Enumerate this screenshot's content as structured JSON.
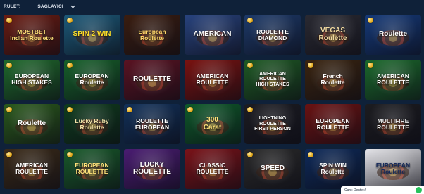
{
  "topbar": {
    "category": "RULET:",
    "provider_label": "SAĞLAYICI",
    "chevron_icon": "chevron-down-icon"
  },
  "games": [
    {
      "slug": "mostbet-indian-roulette",
      "title": "MOSTBET\nIndian Roulette",
      "bg": "#6b1c12",
      "fg": "#ffe27a",
      "coin": true
    },
    {
      "slug": "spin-win",
      "title": "SPIN 2 WIN",
      "bg": "#1c5a7a",
      "fg": "#ffe027",
      "coin": true
    },
    {
      "slug": "european-roulette-1",
      "title": "European Roulette",
      "bg": "#3a1d10",
      "fg": "#ffd86a",
      "coin": false
    },
    {
      "slug": "american-roulette-flag",
      "title": "AMERICAN",
      "bg": "#28437e",
      "fg": "#ffffff",
      "coin": false
    },
    {
      "slug": "roulette-diamond",
      "title": "ROULETTE\nDIAMOND",
      "bg": "#1d3a6a",
      "fg": "#ffffff",
      "coin": true
    },
    {
      "slug": "vegas-roulette",
      "title": "VEGAS\nRoulette",
      "bg": "#2a2a32",
      "fg": "#f1d9a0",
      "coin": false
    },
    {
      "slug": "roulette-blue",
      "title": "Roulette",
      "bg": "#153a7a",
      "fg": "#ffffff",
      "coin": true
    },
    {
      "slug": "european-high-stakes",
      "title": "EUROPEAN\nHIGH STAKES",
      "bg": "#1f6a2c",
      "fg": "#ffffff",
      "coin": true
    },
    {
      "slug": "european-roulette-2",
      "title": "EUROPEAN\nRoulette",
      "bg": "#16612a",
      "fg": "#ffffff",
      "coin": true
    },
    {
      "slug": "live-roulette-dealer",
      "title": "ROULETTE",
      "bg": "#5a1322",
      "fg": "#ffffff",
      "coin": false
    },
    {
      "slug": "american-roulette-red",
      "title": "AMERICAN\nROULETTE",
      "bg": "#7a1210",
      "fg": "#ffffff",
      "coin": false
    },
    {
      "slug": "american-roulette-high-stakes",
      "title": "AMERICAN\nROULETTE\nHIGH STAKES",
      "bg": "#1e5a24",
      "fg": "#ffffff",
      "coin": true
    },
    {
      "slug": "french-roulette",
      "title": "French\nRoulette",
      "bg": "#3a2410",
      "fg": "#ffffff",
      "coin": true
    },
    {
      "slug": "american-roulette-green",
      "title": "AMERICAN\nROULETTE",
      "bg": "#1b6a2c",
      "fg": "#ffffff",
      "coin": true
    },
    {
      "slug": "roulette-green",
      "title": "Roulette",
      "bg": "#2a5a1c",
      "fg": "#ffffff",
      "coin": true
    },
    {
      "slug": "lucky-ruby-european",
      "title": "Lucky Ruby\nRoulette",
      "bg": "#0f3c1d",
      "fg": "#f4e2a8",
      "coin": true
    },
    {
      "slug": "roulette-european",
      "title": "ROULETTE\nEUROPEAN",
      "bg": "#12315a",
      "fg": "#ffffff",
      "coin": true
    },
    {
      "slug": "300-carat-roulette",
      "title": "300\nCarat",
      "bg": "#0e5a2a",
      "fg": "#ffe27a",
      "coin": true
    },
    {
      "slug": "lightning-roulette",
      "title": "LIGHTNING\nROULETTE\nFIRST PERSON",
      "bg": "#1c1c22",
      "fg": "#ffffff",
      "coin": true
    },
    {
      "slug": "european-roulette-3",
      "title": "EUROPEAN\nROULETTE",
      "bg": "#6a1212",
      "fg": "#ffffff",
      "coin": false
    },
    {
      "slug": "multifire-roulette",
      "title": "MULTIFIRE\nROULETTE",
      "bg": "#1c1c20",
      "fg": "#e7e7e7",
      "coin": false
    },
    {
      "slug": "american-roulette-4",
      "title": "AMERICAN\nROULETTE",
      "bg": "#3a2a18",
      "fg": "#ffffff",
      "coin": true
    },
    {
      "slug": "european-roulette-4",
      "title": "EUROPEAN\nROULETTE",
      "bg": "#185a2a",
      "fg": "#ffe27a",
      "coin": true
    },
    {
      "slug": "lucky-roulette",
      "title": "LUCKY\nROULETTE",
      "bg": "#4a1c72",
      "fg": "#ffffff",
      "coin": false
    },
    {
      "slug": "classic-roulette",
      "title": "CLASSIC\nROULETTE",
      "bg": "#7a1218",
      "fg": "#ffffff",
      "coin": false
    },
    {
      "slug": "speed-roulette",
      "title": "SPEED",
      "bg": "#2a2a2a",
      "fg": "#ffffff",
      "coin": true
    },
    {
      "slug": "spin-win-roulette",
      "title": "SPIN WIN\nRoulette",
      "bg": "#0e2a5a",
      "fg": "#ffffff",
      "coin": true
    },
    {
      "slug": "european-roulette-5",
      "title": "EUROPEAN\nRoulette",
      "bg": "#e6e6ea",
      "fg": "#14285a",
      "coin": false
    }
  ],
  "chat": {
    "label": "Canlı Destek!",
    "icon": "chat-icon"
  }
}
